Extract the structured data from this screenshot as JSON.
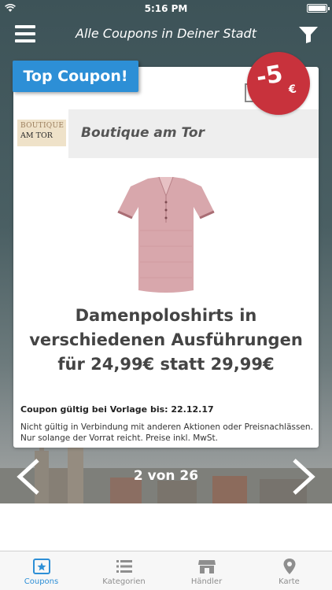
{
  "status_bar": {
    "time": "5:16 PM"
  },
  "header": {
    "title": "Alle Coupons in Deiner Stadt"
  },
  "coupon": {
    "badge": "Top Coupon!",
    "merchant_logo": {
      "line1": "BOUTIQUE",
      "line2": "AM TOR"
    },
    "merchant_name": "Boutique am Tor",
    "discount": {
      "value": "-5",
      "currency": "€"
    },
    "headline": [
      "Damenpoloshirts in",
      "verschiedenen Ausführungen",
      "für 24,99€ statt 29,99€"
    ],
    "validity": "Coupon gültig bei Vorlage bis: 22.12.17",
    "conditions": "Nicht gültig in Verbindung mit anderen Aktionen oder Preisnachlässen. Nur solange der Vorrat reicht. Preise inkl. MwSt."
  },
  "pager": {
    "label": "2 von 26"
  },
  "tabs": [
    {
      "label": "Coupons",
      "icon": "coupon-star-icon",
      "active": true
    },
    {
      "label": "Kategorien",
      "icon": "list-icon",
      "active": false
    },
    {
      "label": "Händler",
      "icon": "store-icon",
      "active": false
    },
    {
      "label": "Karte",
      "icon": "map-pin-icon",
      "active": false
    }
  ],
  "colors": {
    "accent": "#2d8fd6",
    "discount": "#c8323c",
    "tab_inactive": "#8e8e8e"
  }
}
